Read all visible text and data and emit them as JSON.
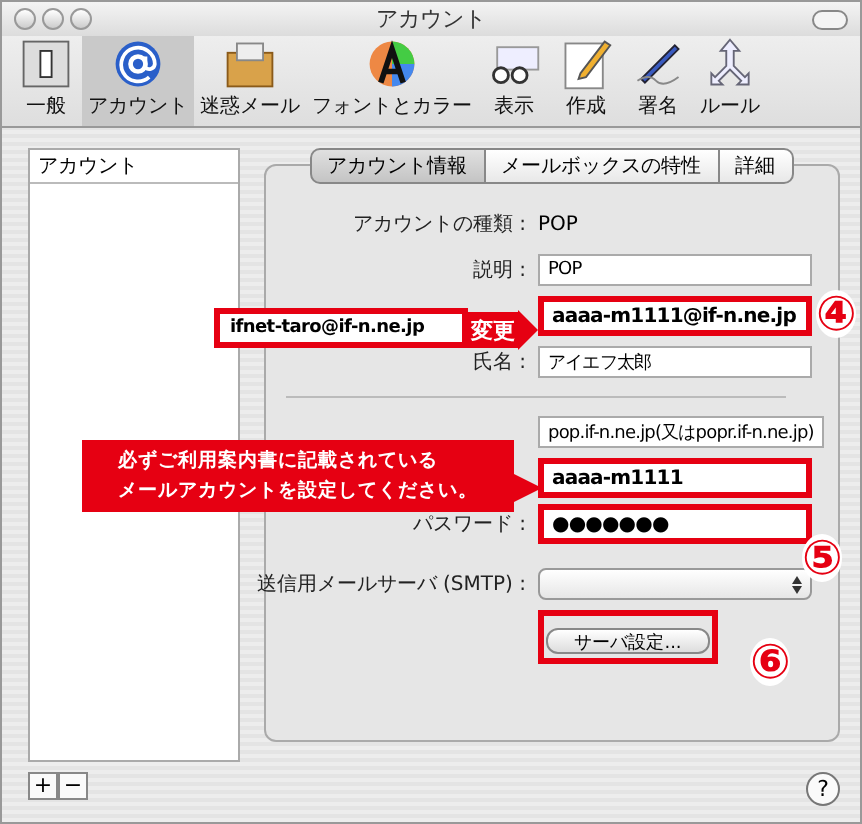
{
  "window": {
    "title": "アカウント"
  },
  "toolbar": [
    {
      "kind": "general",
      "label": "一般",
      "selected": false
    },
    {
      "kind": "account",
      "label": "アカウント",
      "selected": true
    },
    {
      "kind": "junk",
      "label": "迷惑メール",
      "selected": false
    },
    {
      "kind": "fonts",
      "label": "フォントとカラー",
      "selected": false
    },
    {
      "kind": "view",
      "label": "表示",
      "selected": false
    },
    {
      "kind": "compose",
      "label": "作成",
      "selected": false
    },
    {
      "kind": "signature",
      "label": "署名",
      "selected": false
    },
    {
      "kind": "rules",
      "label": "ルール",
      "selected": false
    }
  ],
  "account_list": {
    "header": "アカウント",
    "buttons": [
      "+",
      "−"
    ]
  },
  "tabs": [
    {
      "label": "アカウント情報",
      "selected": true
    },
    {
      "label": "メールボックスの特性",
      "selected": false
    },
    {
      "label": "詳細",
      "selected": false
    }
  ],
  "rows": [
    {
      "kind": "static",
      "label": "アカウントの種類 :",
      "value": "POP"
    },
    {
      "kind": "text",
      "label": "説明 :",
      "value": "POP",
      "highlighted": false
    },
    {
      "kind": "text",
      "value": "aaaa-m1111@if-n.ne.jp",
      "highlighted": true
    },
    {
      "kind": "text",
      "label": "氏名 :",
      "value": "アイエフ太郎",
      "highlighted": false
    },
    {
      "kind": "divider"
    },
    {
      "kind": "text",
      "value": "pop.if-n.ne.jp(又はpopr.if-n.ne.jp)",
      "highlighted": false
    },
    {
      "kind": "text",
      "value": "aaaa-m1111",
      "highlighted": true
    },
    {
      "kind": "password",
      "label": "パスワード :",
      "value": "●●●●●●●",
      "highlighted": true
    },
    {
      "kind": "popup",
      "label": "送信用メールサーバ (SMTP) :"
    },
    {
      "kind": "button",
      "value": "サーバ設定...",
      "highlighted": true
    }
  ],
  "annotations": {
    "old_value": "ifnet-taro@if-n.ne.jp",
    "change_label": "変更",
    "callout": [
      "必ずご利用案内書に記載されている",
      "メールアカウントを設定してください。"
    ],
    "markers": [
      "④",
      "⑤",
      "⑥"
    ]
  },
  "help_button": "?"
}
